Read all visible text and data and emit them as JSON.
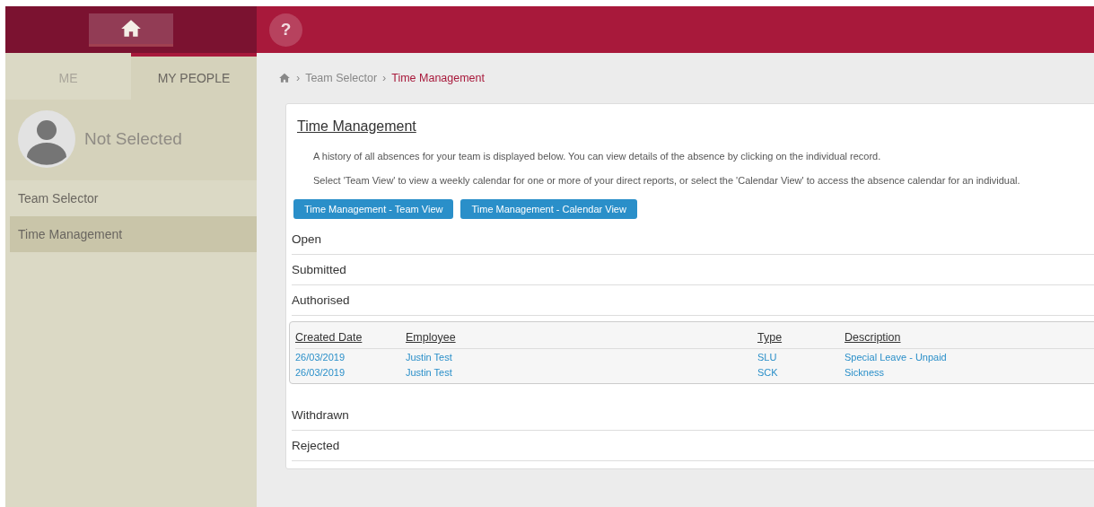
{
  "header": {
    "help_label": "?"
  },
  "sidebar": {
    "tabs": [
      {
        "label": "ME",
        "selected": false
      },
      {
        "label": "MY PEOPLE",
        "selected": true
      }
    ],
    "profile": {
      "name": "Not Selected"
    },
    "items": [
      {
        "label": "Team Selector",
        "selected": false
      },
      {
        "label": "Time Management",
        "selected": true
      }
    ]
  },
  "breadcrumb": {
    "separator": "›",
    "items": [
      "Team Selector",
      "Time Management"
    ]
  },
  "card": {
    "title": "Time Management",
    "paragraphs": [
      "A history of all absences for your team is displayed below. You can view details of the absence by clicking on the individual record.",
      "Select 'Team View' to view a weekly calendar for one or more of your direct reports, or select the 'Calendar View' to access the absence calendar for an individual."
    ],
    "buttons": [
      "Time Management - Team View",
      "Time Management - Calendar View"
    ],
    "sections": [
      {
        "label": "Open"
      },
      {
        "label": "Submitted"
      },
      {
        "label": "Authorised",
        "table": {
          "columns": [
            "Created Date",
            "Employee",
            "Type",
            "Description"
          ],
          "rows": [
            [
              "26/03/2019",
              "Justin Test",
              "SLU",
              "Special Leave - Unpaid"
            ],
            [
              "26/03/2019",
              "Justin Test",
              "SCK",
              "Sickness"
            ]
          ]
        }
      },
      {
        "label": "Withdrawn"
      },
      {
        "label": "Rejected"
      }
    ]
  }
}
